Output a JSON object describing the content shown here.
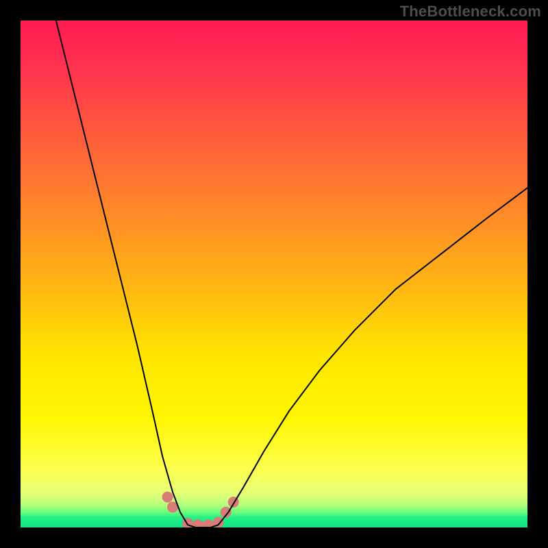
{
  "watermark": "TheBottleneck.com",
  "chart_data": {
    "type": "line",
    "title": "",
    "xlabel": "",
    "ylabel": "",
    "xlim": [
      0,
      100
    ],
    "ylim": [
      0,
      100
    ],
    "grid": false,
    "legend": false,
    "description": "Bottleneck curve on a vertical red→green gradient background. Two black curve branches descend from the top (left branch steep, right branch shallower) to meet in a narrow trough near the bottom around x≈35; small salmon-colored dots mark points along the trough.",
    "gradient_stops": [
      {
        "pos": 0,
        "color": "#ff1a53"
      },
      {
        "pos": 0.22,
        "color": "#ff5a3d"
      },
      {
        "pos": 0.52,
        "color": "#ffb514"
      },
      {
        "pos": 0.78,
        "color": "#fff600"
      },
      {
        "pos": 0.95,
        "color": "#b6ff7c"
      },
      {
        "pos": 1.0,
        "color": "#14e07f"
      }
    ],
    "series": [
      {
        "name": "left-branch",
        "x": [
          7,
          11,
          15,
          19,
          23,
          26,
          28,
          30,
          31.5,
          33
        ],
        "y": [
          100,
          84,
          68,
          52,
          36,
          23,
          14,
          7,
          3,
          0.5
        ],
        "stroke": "#000000"
      },
      {
        "name": "trough",
        "x": [
          33,
          34.5,
          36,
          37.5,
          39
        ],
        "y": [
          0.5,
          0,
          0,
          0,
          0.5
        ],
        "stroke": "#000000"
      },
      {
        "name": "right-branch",
        "x": [
          39,
          41,
          44,
          48,
          53,
          59,
          66,
          74,
          83,
          92,
          100
        ],
        "y": [
          0.5,
          3,
          8,
          15,
          23,
          31,
          39,
          47,
          54,
          61,
          67
        ],
        "stroke": "#000000"
      }
    ],
    "markers": {
      "name": "trough-dots",
      "color": "#d97b77",
      "radius_px": 8,
      "x": [
        29,
        30,
        33,
        35,
        37,
        39,
        40.5,
        42
      ],
      "y": [
        6,
        4,
        0.8,
        0.5,
        0.5,
        1,
        3,
        5
      ]
    }
  }
}
